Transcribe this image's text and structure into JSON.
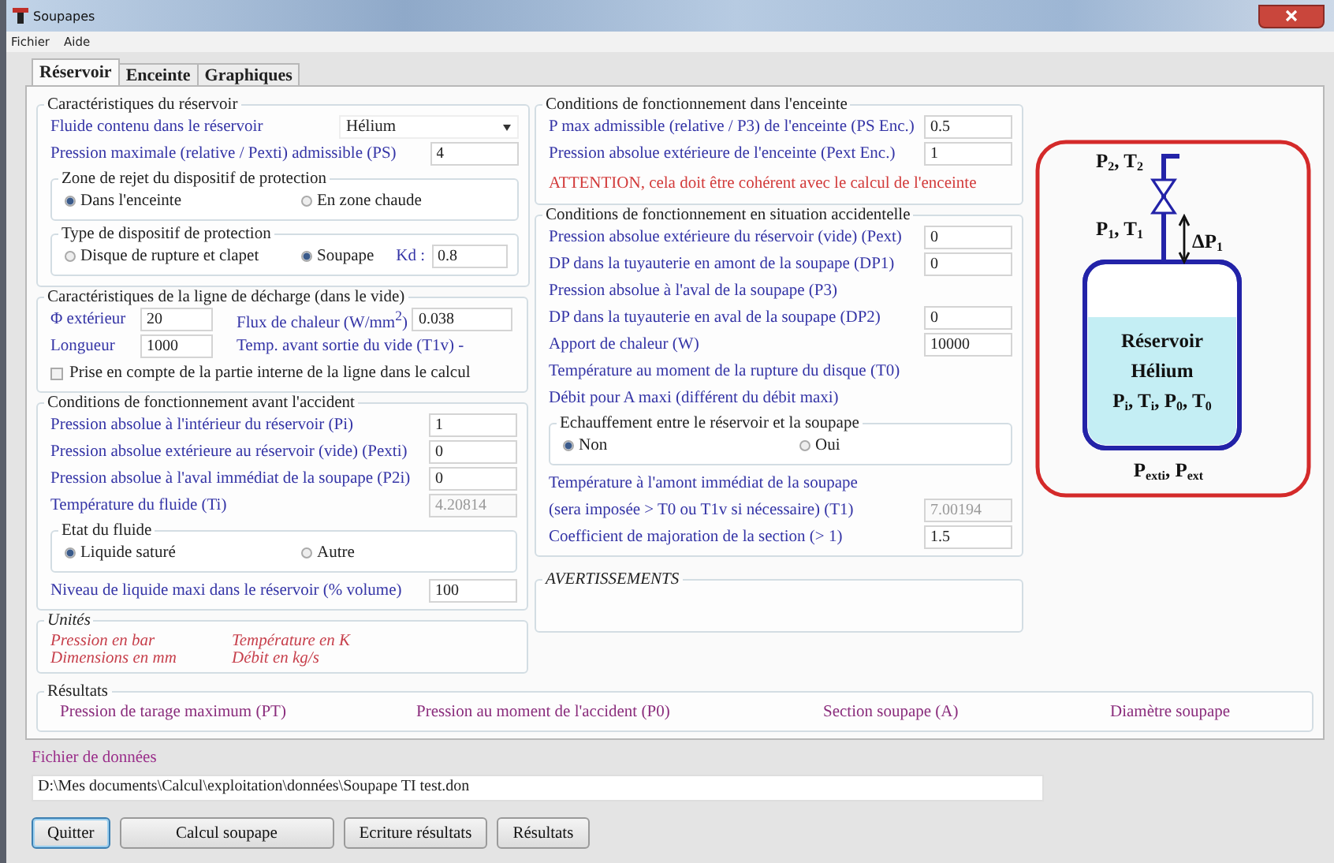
{
  "window": {
    "title": "Soupapes"
  },
  "menu": [
    "Fichier",
    "Aide"
  ],
  "tabs": [
    {
      "label": "Réservoir",
      "selected": true
    },
    {
      "label": "Enceinte",
      "selected": false
    },
    {
      "label": "Graphiques",
      "selected": false
    }
  ],
  "left": [
    {
      "title": "Caractéristiques du réservoir",
      "kind": "form",
      "rows": [
        {
          "kind": "select",
          "label": "Fluide contenu dans le réservoir",
          "value": "Hélium"
        },
        {
          "kind": "field",
          "label": "Pression maximale (relative / Pexti) admissible (PS)",
          "value": "4",
          "disabled": false
        },
        {
          "kind": "radios",
          "title": "Zone de rejet du dispositif de protection",
          "options": [
            {
              "label": "Dans l'enceinte",
              "selected": true
            },
            {
              "label": "En zone chaude",
              "selected": false
            }
          ]
        },
        {
          "kind": "radios",
          "title": "Type de dispositif de protection",
          "options": [
            {
              "label": "Disque de rupture et clapet",
              "selected": false
            },
            {
              "label": "Soupape",
              "selected": true
            }
          ],
          "extra": {
            "label": "Kd :",
            "value": "0.8"
          }
        }
      ]
    },
    {
      "title": "Caractéristiques de la ligne de décharge (dans le vide)",
      "kind": "form",
      "rows": [
        {
          "kind": "pair",
          "items": [
            {
              "label": "Φ extérieur",
              "value": "20"
            },
            {
              "label": "Flux de chaleur (W/mm$^{2}$)",
              "value": "0.038"
            }
          ]
        },
        {
          "kind": "pair",
          "items": [
            {
              "label": "Longueur",
              "value": "1000"
            },
            {
              "label": "Temp. avant sortie du vide (T1v) -"
            }
          ]
        },
        {
          "kind": "checkbox",
          "label": "Prise en compte de la partie interne de la ligne dans le calcul",
          "checked": false
        }
      ]
    },
    {
      "title": "Conditions de fonctionnement avant l'accident",
      "kind": "form",
      "rows": [
        {
          "kind": "field",
          "label": "Pression absolue à l'intérieur du réservoir (Pi)",
          "value": "1",
          "disabled": false
        },
        {
          "kind": "field",
          "label": "Pression absolue extérieure au réservoir (vide) (Pexti)",
          "value": "0",
          "disabled": false
        },
        {
          "kind": "field",
          "label": "Pression absolue à l'aval immédiat de la soupape (P2i)",
          "value": "0",
          "disabled": false
        },
        {
          "kind": "field",
          "label": "Température du fluide (Ti)",
          "value": "4.20814",
          "disabled": true
        },
        {
          "kind": "radios",
          "title": "Etat du fluide",
          "options": [
            {
              "label": "Liquide saturé",
              "selected": true
            },
            {
              "label": "Autre",
              "selected": false
            }
          ]
        },
        {
          "kind": "field",
          "label": "Niveau de liquide maxi dans le réservoir (% volume)",
          "value": "100",
          "disabled": false
        }
      ]
    },
    {
      "title": "Unités",
      "kind": "notes",
      "rows": [
        {
          "kind": "units",
          "items": [
            "Pression en bar",
            "Température en K",
            "Dimensions en mm",
            "Débit en kg/s"
          ]
        }
      ]
    }
  ],
  "middle": [
    {
      "title": "Conditions de fonctionnement dans l'enceinte",
      "kind": "form",
      "rows": [
        {
          "kind": "field",
          "label": "P max admissible (relative / P3) de l'enceinte (PS Enc.)",
          "value": "0.5",
          "disabled": false
        },
        {
          "kind": "field",
          "label": "Pression absolue extérieure de l'enceinte (Pext Enc.)",
          "value": "1",
          "disabled": false
        },
        {
          "kind": "warning",
          "label": "ATTENTION, cela doit être cohérent avec le calcul de l'enceinte"
        }
      ]
    },
    {
      "title": "Conditions de fonctionnement en situation accidentelle",
      "kind": "form",
      "rows": [
        {
          "kind": "field",
          "label": "Pression absolue extérieure du réservoir (vide) (Pext)",
          "value": "0",
          "disabled": false
        },
        {
          "kind": "field",
          "label": "DP dans la tuyauterie en amont de la soupape (DP1)",
          "value": "0",
          "disabled": false
        },
        {
          "kind": "label",
          "label": "Pression absolue à l'aval de la soupape (P3)"
        },
        {
          "kind": "field",
          "label": "DP dans la tuyauterie en aval de la soupape (DP2)",
          "value": "0",
          "disabled": false
        },
        {
          "kind": "field",
          "label": "Apport de chaleur (W)",
          "value": "10000",
          "disabled": false
        },
        {
          "kind": "label",
          "label": "Température au moment de la rupture du disque (T0)"
        },
        {
          "kind": "label",
          "label": "Débit pour A maxi (différent du débit maxi)"
        },
        {
          "kind": "radios",
          "title": "Echauffement entre le réservoir et la soupape",
          "options": [
            {
              "label": "Non",
              "selected": true
            },
            {
              "label": "Oui",
              "selected": false
            }
          ]
        },
        {
          "kind": "label",
          "label": "Température à l'amont immédiat de la soupape"
        },
        {
          "kind": "field",
          "label": "(sera imposée > T0 ou T1v si nécessaire) (T1)",
          "value": "7.00194",
          "disabled": true
        },
        {
          "kind": "field",
          "label": "Coefficient de majoration de la section (> 1)",
          "value": "1.5",
          "disabled": false
        }
      ]
    },
    {
      "title": "AVERTISSEMENTS",
      "kind": "notes"
    }
  ],
  "diagram": {
    "outlet": "P$_{2}$, T$_{2}$",
    "inlet": "P$_{1}$, T$_{1}$",
    "pressure_drop": "ΔP$_{1}$",
    "tank_title": "Réservoir",
    "tank_fluid": "Hélium",
    "tank_conditions": "P$_{i}$, T$_{i}$, P$_{0}$, T$_{0}$",
    "outside": "P$_{exti}$, P$_{ext}$"
  },
  "results": {
    "title": "Résultats",
    "items": [
      "Pression de tarage maximum (PT)",
      "Pression au moment de l'accident (P0)",
      "Section soupape (A)",
      "Diamètre soupape"
    ]
  },
  "data_file": {
    "label": "Fichier de données",
    "value": "D:\\Mes documents\\Calcul\\exploitation\\données\\Soupape TI test.don"
  },
  "buttons": [
    {
      "label": "Quitter",
      "focused": true
    },
    {
      "label": "Calcul soupape",
      "focused": false
    },
    {
      "label": "Ecriture résultats",
      "focused": false
    },
    {
      "label": "Résultats",
      "focused": false
    }
  ]
}
